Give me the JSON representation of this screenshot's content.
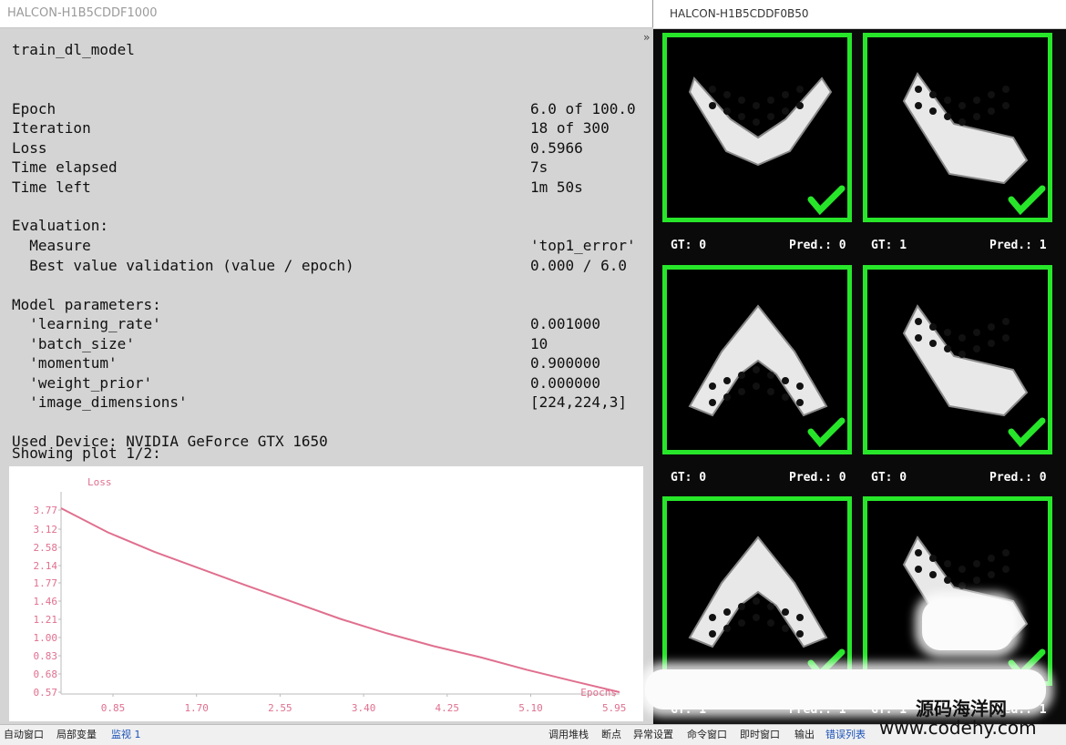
{
  "left_window": {
    "title": "HALCON-H1B5CDDF1000",
    "edge_glyph": "»"
  },
  "right_window": {
    "title": "HALCON-H1B5CDDF0B50",
    "tiles": [
      {
        "gt": "GT: 0",
        "pred": "Pred.: 0",
        "shape": "v-slotted"
      },
      {
        "gt": "GT: 1",
        "pred": "Pred.: 1",
        "shape": "v-holes"
      },
      {
        "gt": "GT: 0",
        "pred": "Pred.: 0",
        "shape": "arch-slotted"
      },
      {
        "gt": "GT: 0",
        "pred": "Pred.: 0",
        "shape": "v-slotted"
      },
      {
        "gt": "GT: 1",
        "pred": "Pred.: 1",
        "shape": "arch-holes"
      },
      {
        "gt": "GT: 1",
        "pred": "Pred.: 1",
        "shape": "v-holes"
      }
    ],
    "check_icon": "check-icon",
    "border_color": "#27e62a"
  },
  "report": {
    "heading": "train_dl_model",
    "rows": [
      {
        "label": "Epoch",
        "value": "6.0 of 100.0"
      },
      {
        "label": "Iteration",
        "value": "18 of 300"
      },
      {
        "label": "Loss",
        "value": "0.5966"
      },
      {
        "label": "Time elapsed",
        "value": "7s"
      },
      {
        "label": "Time left",
        "value": "1m 50s"
      }
    ],
    "evaluation_heading": "Evaluation:",
    "evaluation_rows": [
      {
        "label": "  Measure",
        "value": "'top1_error'"
      },
      {
        "label": "  Best value validation (value / epoch)",
        "value": "0.000 / 6.0"
      }
    ],
    "params_heading": "Model parameters:",
    "params_rows": [
      {
        "label": "  'learning_rate'",
        "value": "0.001000"
      },
      {
        "label": "  'batch_size'",
        "value": "10"
      },
      {
        "label": "  'momentum'",
        "value": "0.900000"
      },
      {
        "label": "  'weight_prior'",
        "value": "0.000000"
      },
      {
        "label": "  'image_dimensions'",
        "value": "[224,224,3]"
      }
    ],
    "device": "Used Device: NVIDIA GeForce GTX 1650",
    "plot_status": "Showing plot 1/2:"
  },
  "chart_data": {
    "type": "line",
    "title": "Loss",
    "xlabel": "Epochs",
    "ylabel": "",
    "x_ticks": [
      "0.85",
      "1.70",
      "2.55",
      "3.40",
      "4.25",
      "5.10",
      "5.95"
    ],
    "y_ticks": [
      "3.77",
      "3.12",
      "2.58",
      "2.14",
      "1.77",
      "1.46",
      "1.21",
      "1.00",
      "0.83",
      "0.68",
      "0.57"
    ],
    "series": [
      {
        "color": "#e0708f",
        "x": [
          0.0,
          0.5,
          1.0,
          1.5,
          2.0,
          2.5,
          3.0,
          3.5,
          4.0,
          4.5,
          5.0,
          5.5,
          6.0
        ],
        "y": [
          3.85,
          3.0,
          2.45,
          2.05,
          1.72,
          1.45,
          1.22,
          1.05,
          0.92,
          0.82,
          0.72,
          0.64,
          0.57
        ]
      }
    ]
  },
  "status_bar": {
    "items_left": [
      "自动窗口",
      "局部变量",
      "监视 1"
    ],
    "items_right": [
      "调用堆栈",
      "断点",
      "异常设置",
      "命令窗口",
      "即时窗口",
      "输出",
      "错误列表"
    ]
  },
  "watermark": {
    "name": "源码海洋网",
    "url": "www.codehy.com"
  }
}
